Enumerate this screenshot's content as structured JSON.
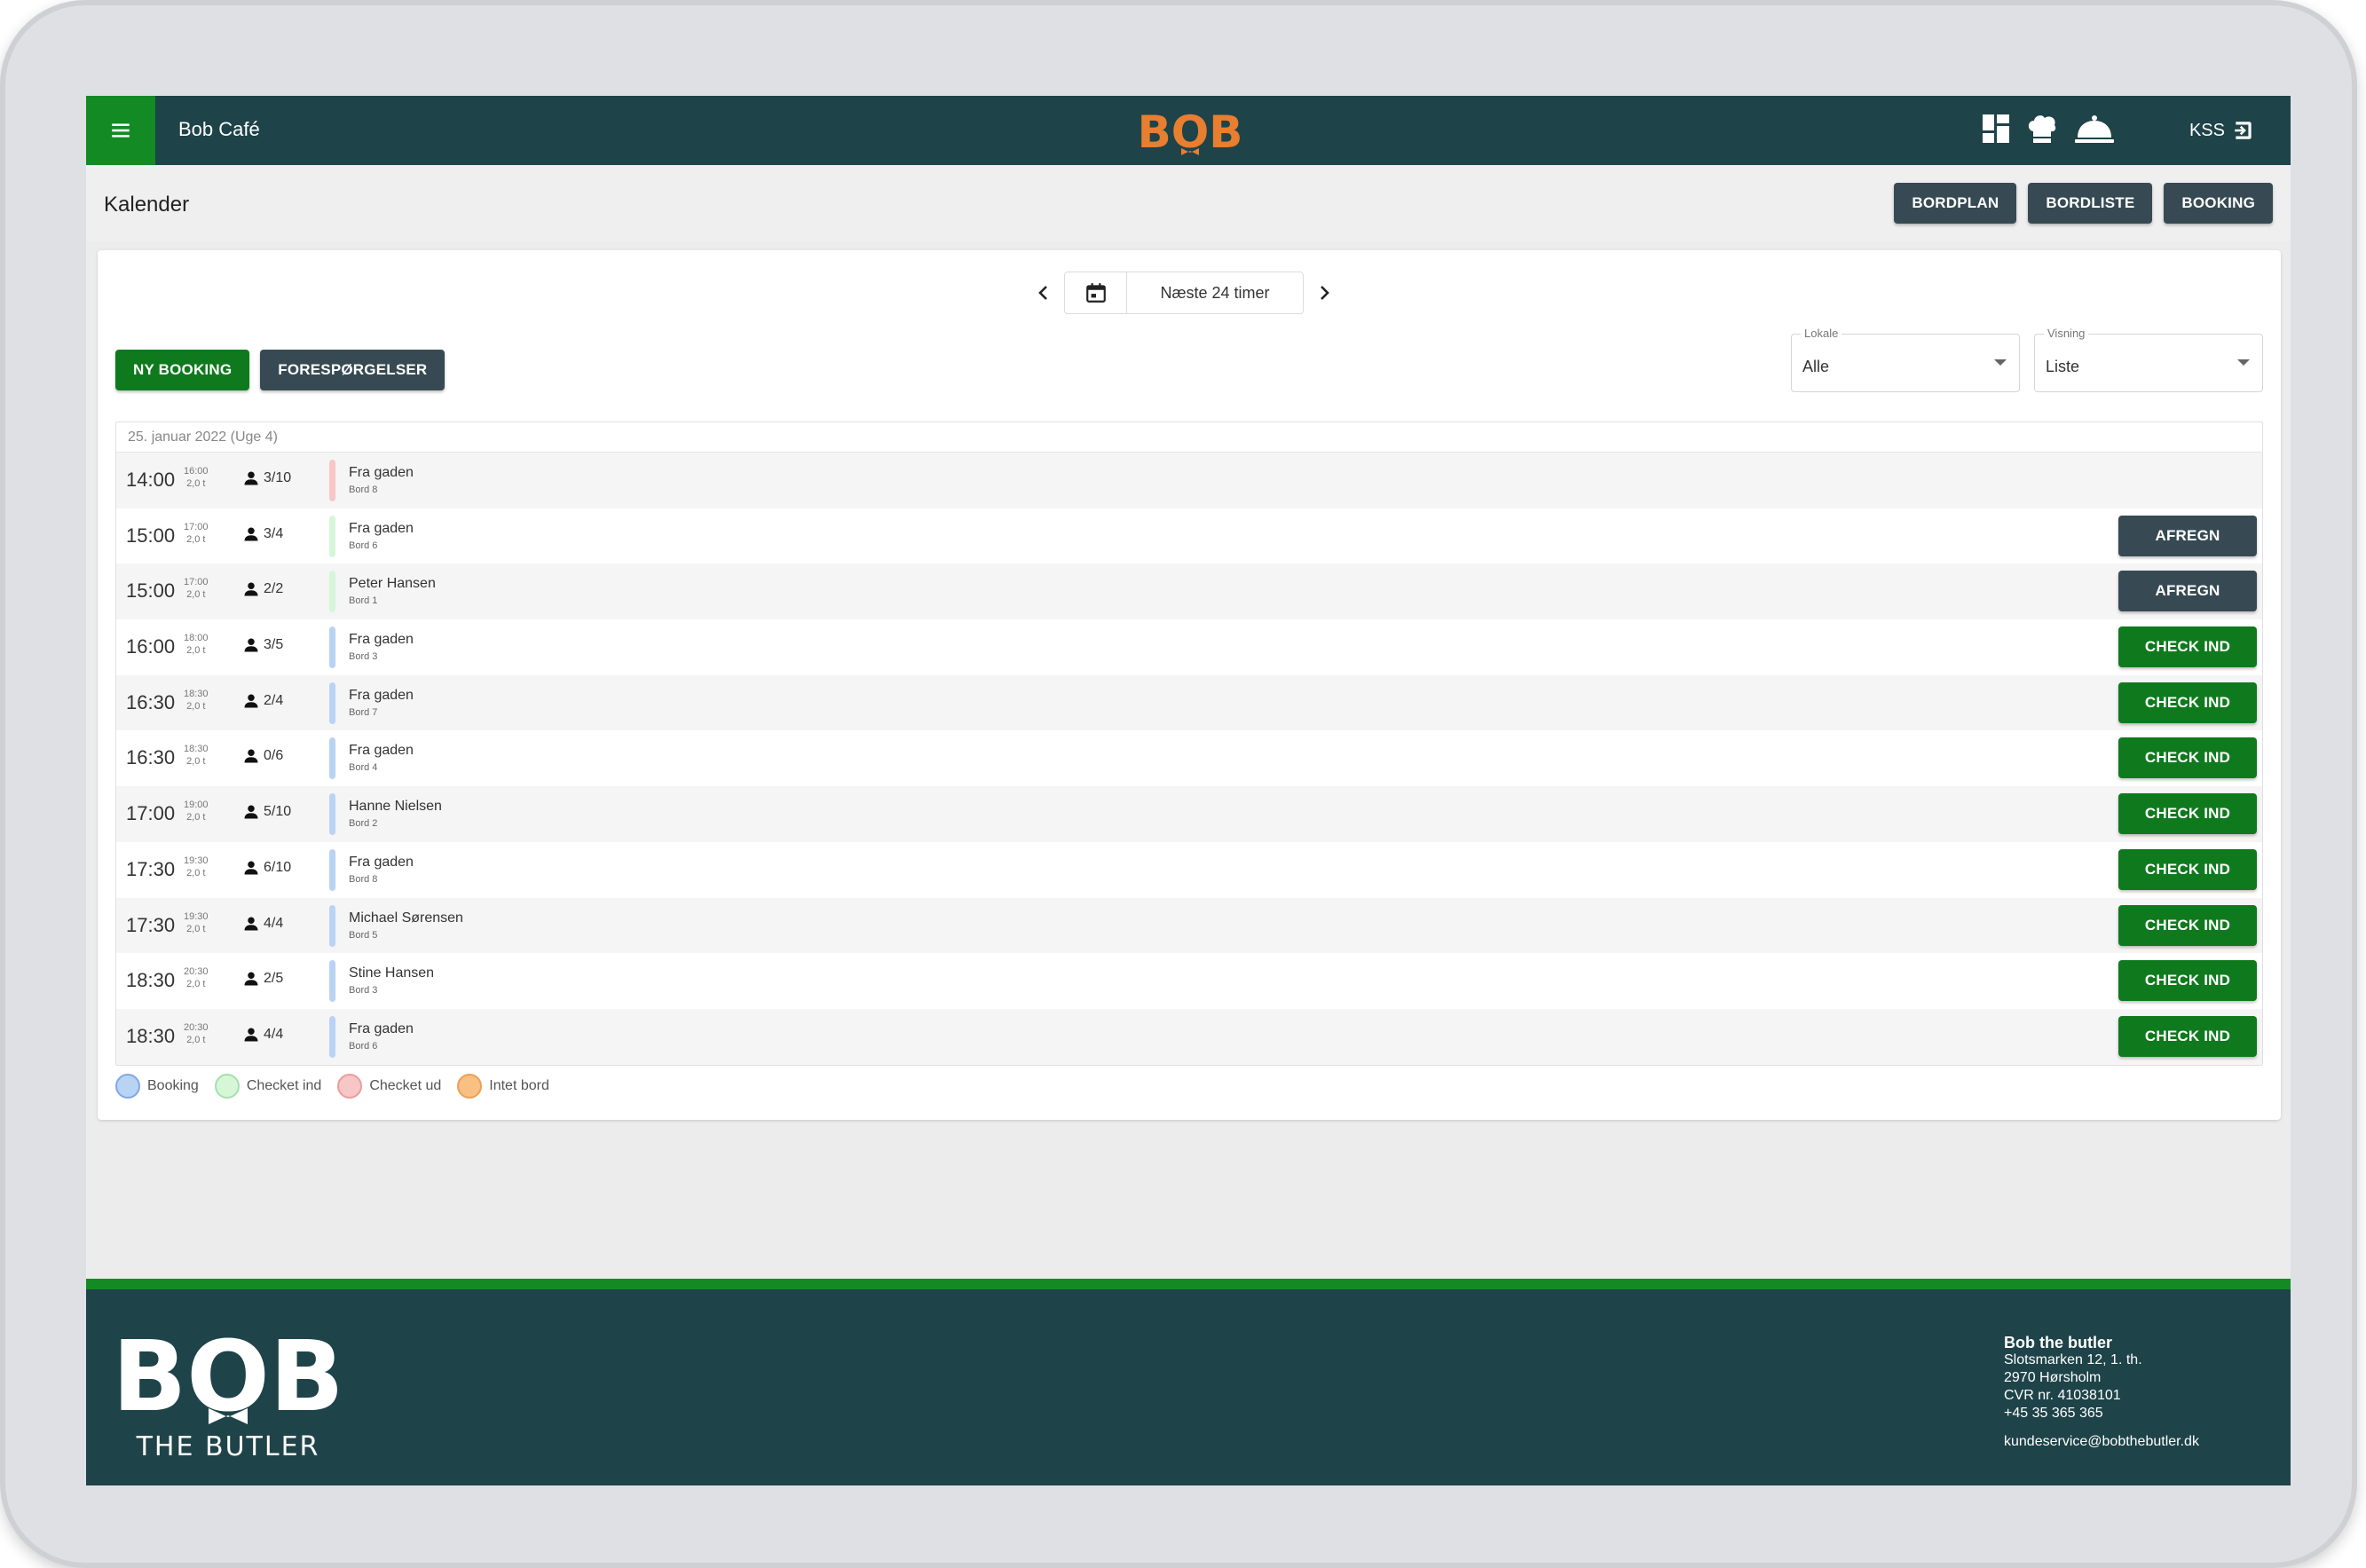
{
  "app": {
    "name": "Bob Café",
    "logo_text": "BOB",
    "user": "KSS"
  },
  "colors": {
    "primary_dark": "#1e4349",
    "accent_green": "#138a24",
    "logo_orange": "#e87e2f",
    "button_dark": "#374a53"
  },
  "icons": {
    "menu": "menu-icon",
    "dashboard": "dashboard-icon",
    "chef": "chef-hat-icon",
    "bell": "service-bell-icon",
    "logout": "logout-icon"
  },
  "page": {
    "title": "Kalender"
  },
  "header_actions": {
    "bordplan": "BORDPLAN",
    "bordliste": "BORDLISTE",
    "booking": "BOOKING"
  },
  "date_nav": {
    "label": "Næste 24 timer"
  },
  "actions": {
    "new_booking": "NY BOOKING",
    "requests": "FORESPØRGELSER"
  },
  "filters": {
    "lokale": {
      "label": "Lokale",
      "value": "Alle"
    },
    "visning": {
      "label": "Visning",
      "value": "Liste"
    }
  },
  "list": {
    "date_header": "25. januar 2022 (Uge 4)",
    "rows": [
      {
        "time": "14:00",
        "end": "16:00",
        "duration": "2,0 t",
        "guests": "3/10",
        "name": "Fra gaden",
        "table": "Bord 8",
        "status": "checked-out",
        "action": ""
      },
      {
        "time": "15:00",
        "end": "17:00",
        "duration": "2,0 t",
        "guests": "3/4",
        "name": "Fra gaden",
        "table": "Bord 6",
        "status": "checked-in",
        "action": "AFREGN"
      },
      {
        "time": "15:00",
        "end": "17:00",
        "duration": "2,0 t",
        "guests": "2/2",
        "name": "Peter Hansen",
        "table": "Bord 1",
        "status": "checked-in",
        "action": "AFREGN"
      },
      {
        "time": "16:00",
        "end": "18:00",
        "duration": "2,0 t",
        "guests": "3/5",
        "name": "Fra gaden",
        "table": "Bord 3",
        "status": "booking",
        "action": "CHECK IND"
      },
      {
        "time": "16:30",
        "end": "18:30",
        "duration": "2,0 t",
        "guests": "2/4",
        "name": "Fra gaden",
        "table": "Bord 7",
        "status": "booking",
        "action": "CHECK IND"
      },
      {
        "time": "16:30",
        "end": "18:30",
        "duration": "2,0 t",
        "guests": "0/6",
        "name": "Fra gaden",
        "table": "Bord 4",
        "status": "booking",
        "action": "CHECK IND"
      },
      {
        "time": "17:00",
        "end": "19:00",
        "duration": "2,0 t",
        "guests": "5/10",
        "name": "Hanne Nielsen",
        "table": "Bord 2",
        "status": "booking",
        "action": "CHECK IND"
      },
      {
        "time": "17:30",
        "end": "19:30",
        "duration": "2,0 t",
        "guests": "6/10",
        "name": "Fra gaden",
        "table": "Bord 8",
        "status": "booking",
        "action": "CHECK IND"
      },
      {
        "time": "17:30",
        "end": "19:30",
        "duration": "2,0 t",
        "guests": "4/4",
        "name": "Michael Sørensen",
        "table": "Bord 5",
        "status": "booking",
        "action": "CHECK IND"
      },
      {
        "time": "18:30",
        "end": "20:30",
        "duration": "2,0 t",
        "guests": "2/5",
        "name": "Stine Hansen",
        "table": "Bord 3",
        "status": "booking",
        "action": "CHECK IND"
      },
      {
        "time": "18:30",
        "end": "20:30",
        "duration": "2,0 t",
        "guests": "4/4",
        "name": "Fra gaden",
        "table": "Bord 6",
        "status": "booking",
        "action": "CHECK IND"
      }
    ]
  },
  "status_colors": {
    "booking": {
      "fill": "#b9d3f5",
      "border": "#7ea9e6"
    },
    "checked-in": {
      "fill": "#d6f6d8",
      "border": "#a6e0ab"
    },
    "checked-out": {
      "fill": "#f7c6c6",
      "border": "#ee9c9c"
    },
    "no-table": {
      "fill": "#f8c083",
      "border": "#eda055"
    }
  },
  "legend": [
    {
      "key": "booking",
      "label": "Booking"
    },
    {
      "key": "checked-in",
      "label": "Checket ind"
    },
    {
      "key": "checked-out",
      "label": "Checket ud"
    },
    {
      "key": "no-table",
      "label": "Intet bord"
    }
  ],
  "footer": {
    "logo_text": "BOB",
    "logo_sub": "THE BUTLER",
    "company": "Bob the butler",
    "address1": "Slotsmarken 12, 1. th.",
    "address2": "2970 Hørsholm",
    "cvr": "CVR nr. 41038101",
    "phone": "+45 35 365 365",
    "email": "kundeservice@bobthebutler.dk"
  }
}
